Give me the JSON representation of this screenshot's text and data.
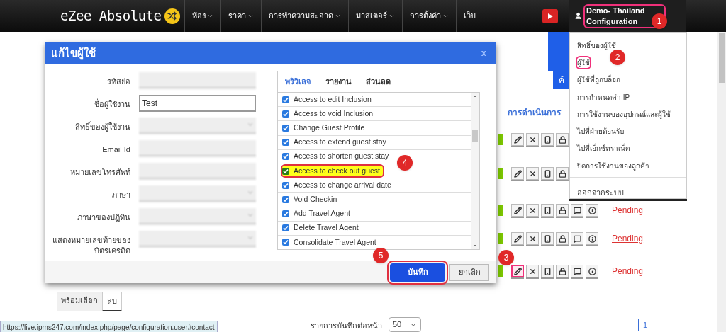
{
  "navbar": {
    "logo": "eZee Absolute",
    "menu": [
      {
        "label": "ห้อง",
        "caret": true
      },
      {
        "label": "ราคา",
        "caret": true
      },
      {
        "label": "การทำความสะอาด",
        "caret": true
      },
      {
        "label": "มาสเตอร์",
        "caret": true
      },
      {
        "label": "การตั้งค่า",
        "caret": true
      },
      {
        "label": "เว็บ",
        "caret": false
      }
    ],
    "user": "Demo- Thailand Configuration"
  },
  "user_menu": {
    "items": [
      {
        "label": "สิทธิ์ของผู้ใช้",
        "highlighted": false
      },
      {
        "label": "ผู้ใช้",
        "highlighted": true
      },
      {
        "label": "ผู้ใช้ที่ถูกบล็อก",
        "highlighted": false
      },
      {
        "label": "การกำหนดค่า IP",
        "highlighted": false
      },
      {
        "label": "การใช้งานของอุปกรณ์และผู้ใช้",
        "highlighted": false
      },
      {
        "label": "ไปที่ฝ่ายต้อนรับ",
        "highlighted": false
      },
      {
        "label": "ไปที่เอ็กซ์ทราเน็ต",
        "highlighted": false
      },
      {
        "label": "ปิดการใช้งานของลูกค้า",
        "highlighted": false
      }
    ],
    "logout": "ออกจากระบบ"
  },
  "page": {
    "search_button": "ค้",
    "table": {
      "column": "การดำเนินการ",
      "rows": [
        {
          "edit_highlighted": false
        },
        {
          "edit_highlighted": false
        },
        {
          "status": "Pending",
          "edit_highlighted": false
        },
        {
          "status": "Pending",
          "edit_highlighted": false
        },
        {
          "status": "Pending",
          "edit_highlighted": true
        }
      ]
    },
    "bottom_tabs": [
      {
        "label": "พร้อมเลือก",
        "selected": false
      },
      {
        "label": "ลบ",
        "selected": true
      }
    ],
    "per_page_label": "รายการบันทึกต่อหน้า",
    "per_page": "50",
    "page": "1"
  },
  "dialog": {
    "title": "แก้ไขผู้ใช้",
    "close": "x",
    "fields": [
      {
        "label": "รหัสย่อ",
        "blurred": true,
        "kind": "input"
      },
      {
        "label": "ชื่อผู้ใช้งาน",
        "value": "Test",
        "blurred": false,
        "kind": "input"
      },
      {
        "label": "สิทธิ์ของผู้ใช้งาน",
        "blurred": true,
        "kind": "select"
      },
      {
        "label": "Email Id",
        "blurred": true,
        "kind": "input"
      },
      {
        "label": "หมายเลขโทรศัพท์",
        "blurred": true,
        "kind": "input"
      },
      {
        "label": "ภาษา",
        "blurred": true,
        "kind": "select"
      },
      {
        "label": "ภาษาของปฏิทิน",
        "blurred": true,
        "kind": "select"
      },
      {
        "label": "แสดงหมายเลขท้ายของบัตรเครดิต",
        "blurred": true,
        "kind": "select"
      }
    ],
    "tabs": [
      {
        "label": "พริวิเลจ",
        "selected": true
      },
      {
        "label": "รายงาน",
        "selected": false
      },
      {
        "label": "ส่วนลด",
        "selected": false
      }
    ],
    "privileges": [
      {
        "label": "Access to edit Inclusion",
        "checked": true,
        "highlighted": false
      },
      {
        "label": "Access to void Inclusion",
        "checked": true,
        "highlighted": false
      },
      {
        "label": "Change Guest Profile",
        "checked": true,
        "highlighted": false
      },
      {
        "label": "Access to extend guest stay",
        "checked": true,
        "highlighted": false
      },
      {
        "label": "Access to shorten guest stay",
        "checked": true,
        "highlighted": false
      },
      {
        "label": "Access to check out guest",
        "checked": true,
        "highlighted": true
      },
      {
        "label": "Access to change arrival date",
        "checked": true,
        "highlighted": false
      },
      {
        "label": "Void Checkin",
        "checked": true,
        "highlighted": false
      },
      {
        "label": "Add Travel Agent",
        "checked": true,
        "highlighted": false
      },
      {
        "label": "Delete Travel Agent",
        "checked": true,
        "highlighted": false
      },
      {
        "label": "Consolidate Travel Agent",
        "checked": true,
        "highlighted": false
      }
    ],
    "save": "บันทึก",
    "cancel": "ยกเลิก"
  },
  "annotations": [
    "1",
    "2",
    "3",
    "4",
    "5"
  ],
  "status_url": "https://live.ipms247.com/index.php/page/configuration.user#contact"
}
